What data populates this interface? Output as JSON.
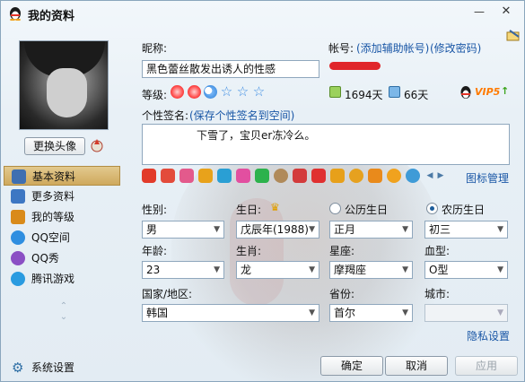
{
  "window": {
    "title": "我的资料",
    "minimize_glyph": "—",
    "close_glyph": "✕"
  },
  "avatar": {
    "change_button": "更换头像"
  },
  "sidebar": {
    "items": [
      {
        "label": "基本资料",
        "icon": "id-card-icon",
        "color": "#3f6fb1",
        "active": true
      },
      {
        "label": "更多资料",
        "icon": "card-icon",
        "color": "#3d77c3",
        "active": false
      },
      {
        "label": "我的等级",
        "icon": "house-level-icon",
        "color": "#d98a1a",
        "active": false
      },
      {
        "label": "QQ空间",
        "icon": "star-qzone-icon",
        "color": "#2f8ee0",
        "active": false
      },
      {
        "label": "QQ秀",
        "icon": "qqshow-icon",
        "color": "#8b4fc4",
        "active": false
      },
      {
        "label": "腾讯游戏",
        "icon": "game-icon",
        "color": "#2a9be0",
        "active": false
      }
    ],
    "settings_label": "系统设置"
  },
  "profile": {
    "nickname_label": "昵称:",
    "nickname_value": "黑色蕾丝散发出诱人的性感",
    "account_label": "帐号:",
    "add_account_link": "(添加辅助帐号)",
    "change_password_link": "(修改密码)",
    "level_label": "等级:",
    "level_icons": [
      "sun-icon",
      "sun-icon",
      "moon-icon",
      "star-icon",
      "star-icon",
      "star-icon"
    ],
    "days_online": "1694天",
    "days_active": "66天",
    "vip_label": "VIP5",
    "vip_up": "↑",
    "signature_label": "个性签名:",
    "signature_link": "(保存个性签名到空间)",
    "signature_value": "下雪了，宝贝er冻冷么。",
    "icon_manage_link": "图标管理"
  },
  "strip_icons": [
    {
      "name": "penguin-icon",
      "color": "#e23b2a"
    },
    {
      "name": "pet-icon",
      "color": "#e34b3b"
    },
    {
      "name": "heart-icon",
      "color": "#e35a8c"
    },
    {
      "name": "mail-icon",
      "color": "#e8a21b"
    },
    {
      "name": "blue-diamond-icon",
      "color": "#2a9fd4"
    },
    {
      "name": "pink-gem-icon",
      "color": "#e24fa0"
    },
    {
      "name": "green-gem-icon",
      "color": "#2cb24c"
    },
    {
      "name": "ball-icon",
      "color": "#b08a5a"
    },
    {
      "name": "music-icon",
      "color": "#d33b3b"
    },
    {
      "name": "red-badge-icon",
      "color": "#e03030"
    },
    {
      "name": "book-icon",
      "color": "#e7a01a"
    },
    {
      "name": "coin-icon",
      "color": "#e6a11f"
    },
    {
      "name": "orange-card-icon",
      "color": "#e98a1b"
    },
    {
      "name": "color-wheel-icon",
      "color": "#f0a21e"
    },
    {
      "name": "soccer-icon",
      "color": "#3f9bd7"
    }
  ],
  "form": {
    "gender_label": "性别:",
    "gender_value": "男",
    "birthday_label": "生日:",
    "birthday_year": "戊辰年(1988)",
    "birthday_month": "正月",
    "birthday_day": "初三",
    "solar_label": "公历生日",
    "lunar_label": "农历生日",
    "age_label": "年龄:",
    "age_value": "23",
    "zodiac_label": "生肖:",
    "zodiac_value": "龙",
    "sign_label": "星座:",
    "sign_value": "摩羯座",
    "blood_label": "血型:",
    "blood_value": "O型",
    "country_label": "国家/地区:",
    "country_value": "韩国",
    "province_label": "省份:",
    "province_value": "首尔",
    "city_label": "城市:",
    "city_value": "",
    "privacy_link": "隐私设置"
  },
  "footer": {
    "ok": "确定",
    "cancel": "取消",
    "apply": "应用"
  }
}
